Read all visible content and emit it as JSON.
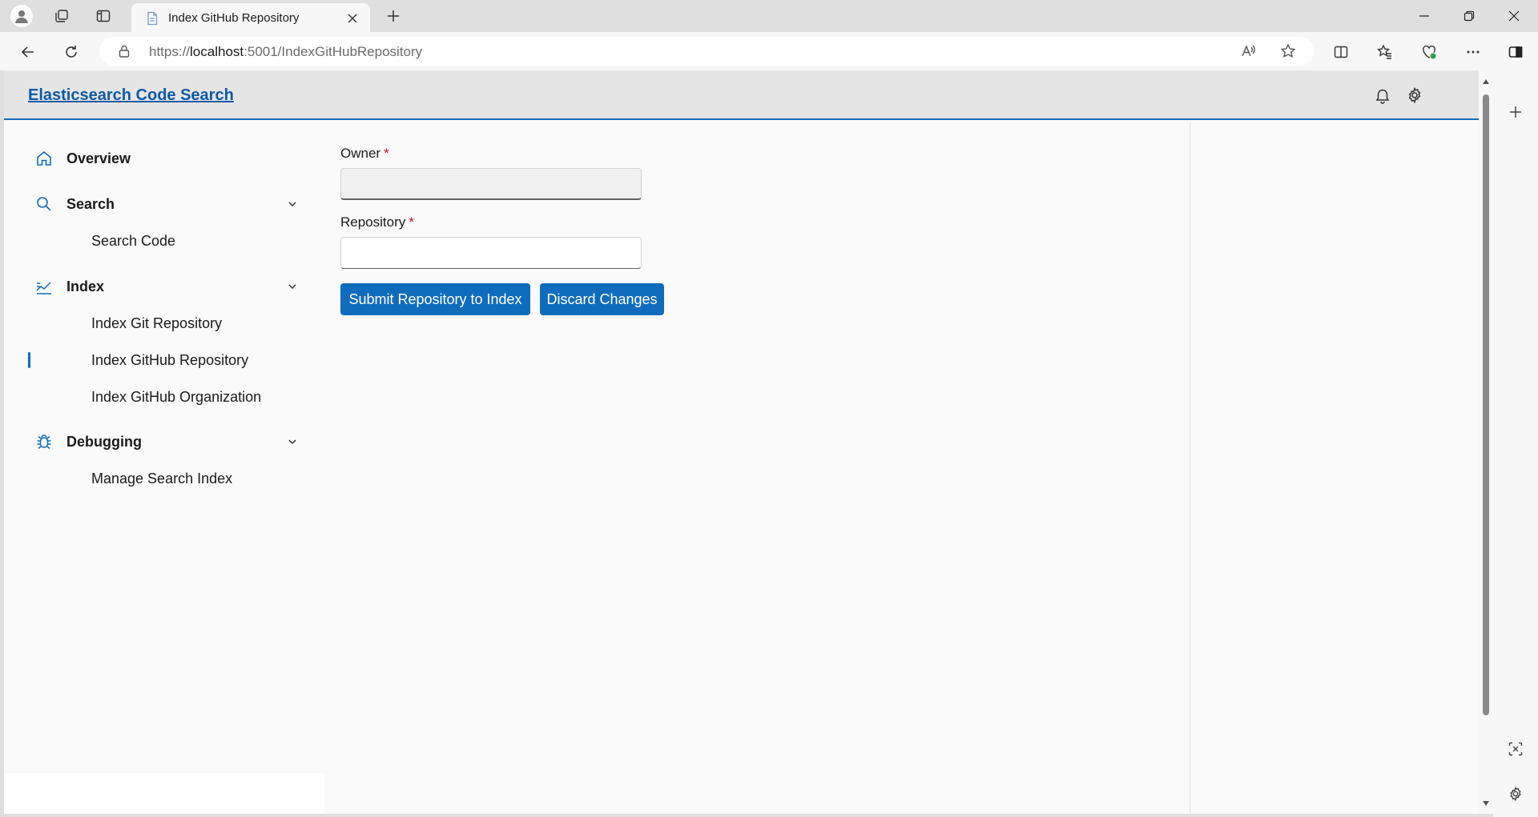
{
  "browser": {
    "tab": {
      "title": "Index GitHub Repository"
    },
    "address": {
      "scheme": "https://",
      "host": "localhost",
      "rest": ":5001/IndexGitHubRepository"
    }
  },
  "app": {
    "title": "Elasticsearch Code Search"
  },
  "nav": {
    "overview": "Overview",
    "search": {
      "label": "Search",
      "items": [
        "Search Code"
      ]
    },
    "index": {
      "label": "Index",
      "items": [
        "Index Git Repository",
        "Index GitHub Repository",
        "Index GitHub Organization"
      ]
    },
    "debugging": {
      "label": "Debugging",
      "items": [
        "Manage Search Index"
      ]
    },
    "selected": "Index GitHub Repository"
  },
  "form": {
    "owner": {
      "label": "Owner",
      "required": "*",
      "value": ""
    },
    "repository": {
      "label": "Repository",
      "required": "*",
      "value": ""
    },
    "submit_label": "Submit Repository to Index",
    "discard_label": "Discard Changes"
  },
  "colors": {
    "accent": "#0f6cbd",
    "required": "#c50f1f",
    "header_bg": "#e5e5e5",
    "page_bg": "#fafafa"
  },
  "icons": {
    "nav_overview": "home-icon",
    "nav_search": "search-icon",
    "nav_index": "index-icon",
    "nav_debugging": "bug-icon",
    "header": [
      "bell-icon",
      "gear-icon"
    ]
  }
}
